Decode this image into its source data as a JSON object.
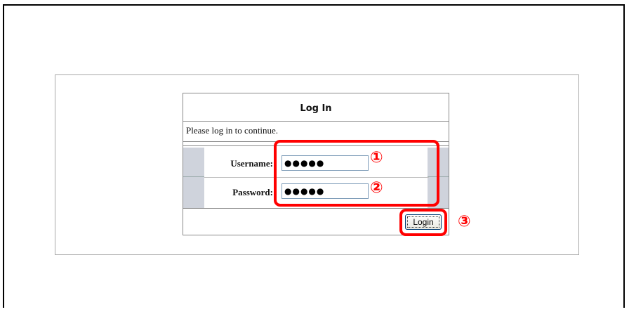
{
  "dialog": {
    "title": "Log In",
    "message": "Please log in to continue.",
    "username_label": "Username:",
    "username_value": "●●●●●",
    "password_label": "Password:",
    "password_value": "●●●●●",
    "login_label": "Login"
  },
  "callouts": {
    "one": "①",
    "two": "②",
    "three": "③"
  },
  "colors": {
    "callout": "#ff0000",
    "strip": "#cfd3dc"
  }
}
